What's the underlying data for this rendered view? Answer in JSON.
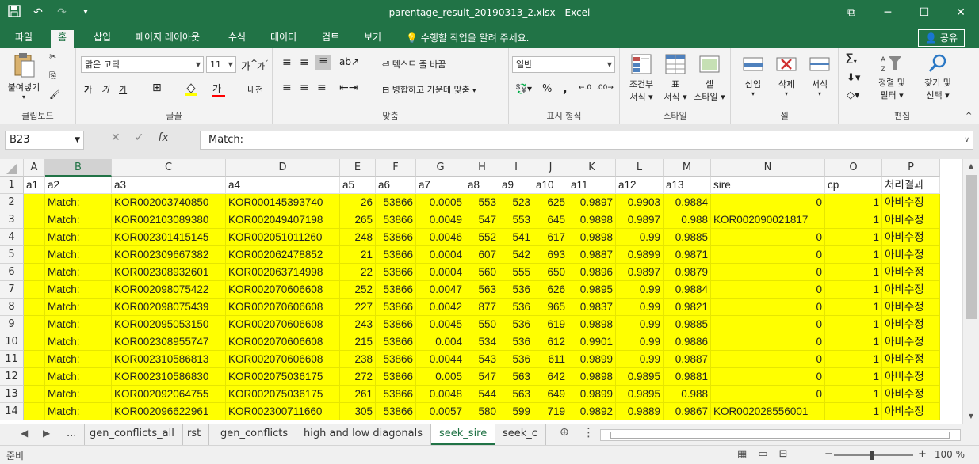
{
  "window": {
    "title": "parentage_result_20190313_2.xlsx - Excel",
    "minimize": "─",
    "maximize": "☐",
    "close": "✕",
    "ribbon_display": "⧉"
  },
  "qat": {
    "save": "💾",
    "undo": "↶",
    "redo": "↷",
    "customize": "▾"
  },
  "tabs": [
    "파일",
    "홈",
    "삽입",
    "페이지 레이아웃",
    "수식",
    "데이터",
    "검토",
    "보기"
  ],
  "tell_me": "수행할 작업을 알려 주세요.",
  "share": "공유",
  "ribbon": {
    "clipboard": {
      "paste": "붙여넣기",
      "label": "클립보드"
    },
    "font": {
      "name": "맑은 고딕",
      "size": "11",
      "label": "글꼴",
      "bold": "가",
      "italic": "가",
      "underline": "가",
      "grow": "가",
      "shrink": "가"
    },
    "alignment": {
      "wrap": "텍스트 줄 바꿈",
      "merge": "병합하고 가운데 맞춤",
      "label": "맞춤"
    },
    "number": {
      "format": "일반",
      "label": "표시 형식",
      "percent": "%",
      "comma": ","
    },
    "styles": {
      "conditional": "조건부\n서식",
      "conditional_1": "조건부",
      "conditional_2": "서식",
      "table_1": "표",
      "table_2": "서식",
      "cell_1": "셀",
      "cell_2": "스타일",
      "label": "스타일"
    },
    "cells": {
      "insert": "삽입",
      "delete": "삭제",
      "format": "서식",
      "label": "셀"
    },
    "editing": {
      "sort_1": "정렬 및",
      "sort_2": "필터",
      "find_1": "찾기 및",
      "find_2": "선택",
      "label": "편집"
    }
  },
  "formula_bar": {
    "name_box": "B23",
    "cancel": "✕",
    "enter": "✓",
    "fx": "fx",
    "content": "Match:"
  },
  "columns": [
    "A",
    "B",
    "C",
    "D",
    "E",
    "F",
    "G",
    "H",
    "I",
    "J",
    "K",
    "L",
    "M",
    "N",
    "O",
    "P"
  ],
  "selected_column": "B",
  "header_row": [
    "a1",
    "a2",
    "a3",
    "a4",
    "a5",
    "a6",
    "a7",
    "a8",
    "a9",
    "a10",
    "a11",
    "a12",
    "a13",
    "sire",
    "cp",
    "처리결과"
  ],
  "rows": [
    [
      "",
      "Match:",
      "KOR002003740850",
      "KOR000145393740",
      "26",
      "53866",
      "0.0005",
      "553",
      "523",
      "625",
      "0.9897",
      "0.9903",
      "0.9884",
      "0",
      "1",
      "아비수정"
    ],
    [
      "",
      "Match:",
      "KOR002103089380",
      "KOR002049407198",
      "265",
      "53866",
      "0.0049",
      "547",
      "553",
      "645",
      "0.9898",
      "0.9897",
      "0.988",
      "KOR002090021817",
      "1",
      "아비수정"
    ],
    [
      "",
      "Match:",
      "KOR002301415145",
      "KOR002051011260",
      "248",
      "53866",
      "0.0046",
      "552",
      "541",
      "617",
      "0.9898",
      "0.99",
      "0.9885",
      "0",
      "1",
      "아비수정"
    ],
    [
      "",
      "Match:",
      "KOR002309667382",
      "KOR002062478852",
      "21",
      "53866",
      "0.0004",
      "607",
      "542",
      "693",
      "0.9887",
      "0.9899",
      "0.9871",
      "0",
      "1",
      "아비수정"
    ],
    [
      "",
      "Match:",
      "KOR002308932601",
      "KOR002063714998",
      "22",
      "53866",
      "0.0004",
      "560",
      "555",
      "650",
      "0.9896",
      "0.9897",
      "0.9879",
      "0",
      "1",
      "아비수정"
    ],
    [
      "",
      "Match:",
      "KOR002098075422",
      "KOR002070606608",
      "252",
      "53866",
      "0.0047",
      "563",
      "536",
      "626",
      "0.9895",
      "0.99",
      "0.9884",
      "0",
      "1",
      "아비수정"
    ],
    [
      "",
      "Match:",
      "KOR002098075439",
      "KOR002070606608",
      "227",
      "53866",
      "0.0042",
      "877",
      "536",
      "965",
      "0.9837",
      "0.99",
      "0.9821",
      "0",
      "1",
      "아비수정"
    ],
    [
      "",
      "Match:",
      "KOR002095053150",
      "KOR002070606608",
      "243",
      "53866",
      "0.0045",
      "550",
      "536",
      "619",
      "0.9898",
      "0.99",
      "0.9885",
      "0",
      "1",
      "아비수정"
    ],
    [
      "",
      "Match:",
      "KOR002308955747",
      "KOR002070606608",
      "215",
      "53866",
      "0.004",
      "534",
      "536",
      "612",
      "0.9901",
      "0.99",
      "0.9886",
      "0",
      "1",
      "아비수정"
    ],
    [
      "",
      "Match:",
      "KOR002310586813",
      "KOR002070606608",
      "238",
      "53866",
      "0.0044",
      "543",
      "536",
      "611",
      "0.9899",
      "0.99",
      "0.9887",
      "0",
      "1",
      "아비수정"
    ],
    [
      "",
      "Match:",
      "KOR002310586830",
      "KOR002075036175",
      "272",
      "53866",
      "0.005",
      "547",
      "563",
      "642",
      "0.9898",
      "0.9895",
      "0.9881",
      "0",
      "1",
      "아비수정"
    ],
    [
      "",
      "Match:",
      "KOR002092064755",
      "KOR002075036175",
      "261",
      "53866",
      "0.0048",
      "544",
      "563",
      "649",
      "0.9899",
      "0.9895",
      "0.988",
      "0",
      "1",
      "아비수정"
    ],
    [
      "",
      "Match:",
      "KOR002096622961",
      "KOR002300711660",
      "305",
      "53866",
      "0.0057",
      "580",
      "599",
      "719",
      "0.9892",
      "0.9889",
      "0.9867",
      "KOR002028556001",
      "1",
      "아비수정"
    ]
  ],
  "row_numbers": [
    "1",
    "2",
    "3",
    "4",
    "5",
    "6",
    "7",
    "8",
    "9",
    "10",
    "11",
    "12",
    "13",
    "14"
  ],
  "sheet_tabs": [
    "...",
    "gen_conflicts_all",
    "rst",
    "gen_conflicts",
    "high and low diagonals",
    "seek_sire",
    "seek_c"
  ],
  "active_sheet": "seek_sire",
  "status": {
    "ready": "준비",
    "zoom": "100 %",
    "zoom_out": "−",
    "zoom_in": "+"
  },
  "colors": {
    "excel_green": "#217346",
    "highlight": "#ffff00"
  }
}
